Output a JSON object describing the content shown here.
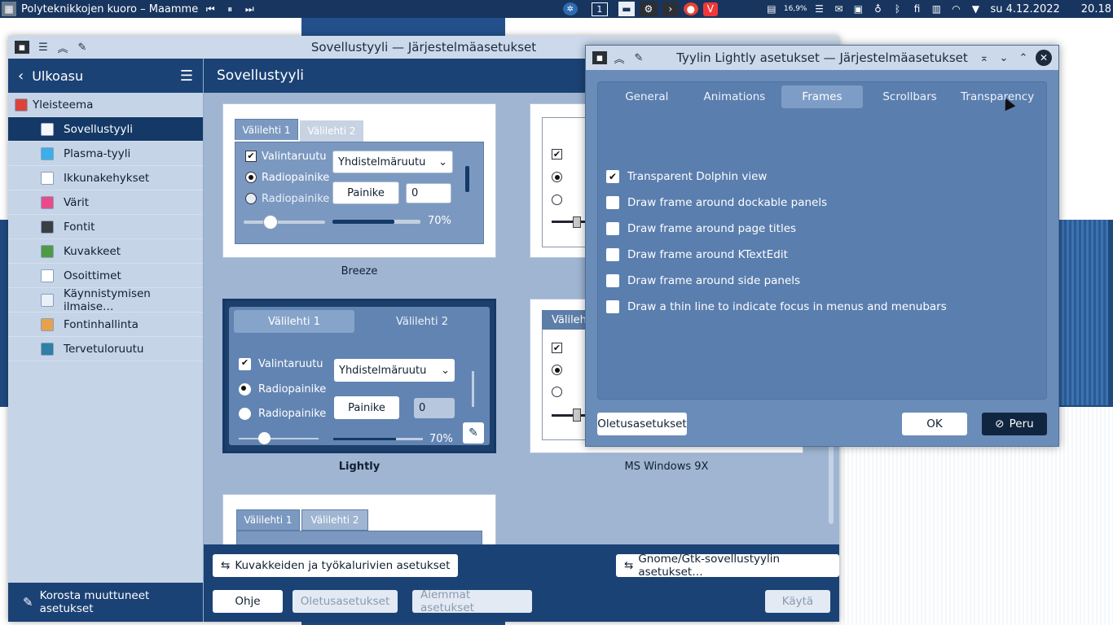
{
  "panel": {
    "media_title": "Polyteknikkojen kuoro – Maamme",
    "desktop_number": "1",
    "battery_percent": "16,9%",
    "date": "su 4.12.2022",
    "time": "20.18"
  },
  "main_window": {
    "title": "Sovellustyyli — Järjestelmäasetukset",
    "sidebar": {
      "back_label": "Ulkoasu",
      "items": [
        {
          "label": "Yleisteema",
          "color": "#d9453b"
        },
        {
          "label": "Sovellustyyli",
          "color": "#f5f7fa"
        },
        {
          "label": "Plasma-tyyli",
          "color": "#3daee9"
        },
        {
          "label": "Ikkunakehykset",
          "color": "#ffffff"
        },
        {
          "label": "Värit",
          "color": "#e84b8a"
        },
        {
          "label": "Fontit",
          "color": "#3a3f44"
        },
        {
          "label": "Kuvakkeet",
          "color": "#4f9b45"
        },
        {
          "label": "Osoittimet",
          "color": "#ffffff"
        },
        {
          "label": "Käynnistymisen ilmaise…",
          "color": "#e9f0f8"
        },
        {
          "label": "Fontinhallinta",
          "color": "#e8a14a"
        },
        {
          "label": "Tervetuloruutu",
          "color": "#2f7fa6"
        }
      ],
      "highlight_label": "Korosta muuttuneet asetukset"
    },
    "content": {
      "header": "Sovellustyyli",
      "preview": {
        "tab1": "Välilehti 1",
        "tab2": "Välilehti 2",
        "checkbox": "Valintaruutu",
        "radio": "Radiopainike",
        "combo": "Yhdistelmäruutu",
        "button": "Painike",
        "spin": "0",
        "percent": "70%",
        "progress": 0.7,
        "tab_short": "Välileh"
      },
      "styles": [
        "Breeze",
        "Lightly",
        "MS Windows 9X"
      ],
      "icons_toolbar_button": "Kuvakkeiden ja työkalurivien asetukset",
      "gtk_button": "Gnome/Gtk-sovellustyylin asetukset…"
    },
    "footer": {
      "help": "Ohje",
      "defaults": "Oletusasetukset",
      "reset": "Aiemmat asetukset",
      "apply": "Käytä"
    }
  },
  "dialog": {
    "title": "Tyylin Lightly asetukset — Järjestelmäasetukset",
    "tabs": [
      "General",
      "Animations",
      "Frames",
      "Scrollbars",
      "Transparency"
    ],
    "options": [
      {
        "label": "Transparent Dolphin view",
        "checked": true
      },
      {
        "label": "Draw frame around dockable panels",
        "checked": false
      },
      {
        "label": "Draw frame around page titles",
        "checked": false
      },
      {
        "label": "Draw frame around KTextEdit",
        "checked": false
      },
      {
        "label": "Draw frame around side panels",
        "checked": false
      },
      {
        "label": "Draw a thin line to indicate focus in menus and menubars",
        "checked": false
      }
    ],
    "defaults_button": "Oletusasetukset",
    "ok_button": "OK",
    "cancel_button": "Peru"
  }
}
